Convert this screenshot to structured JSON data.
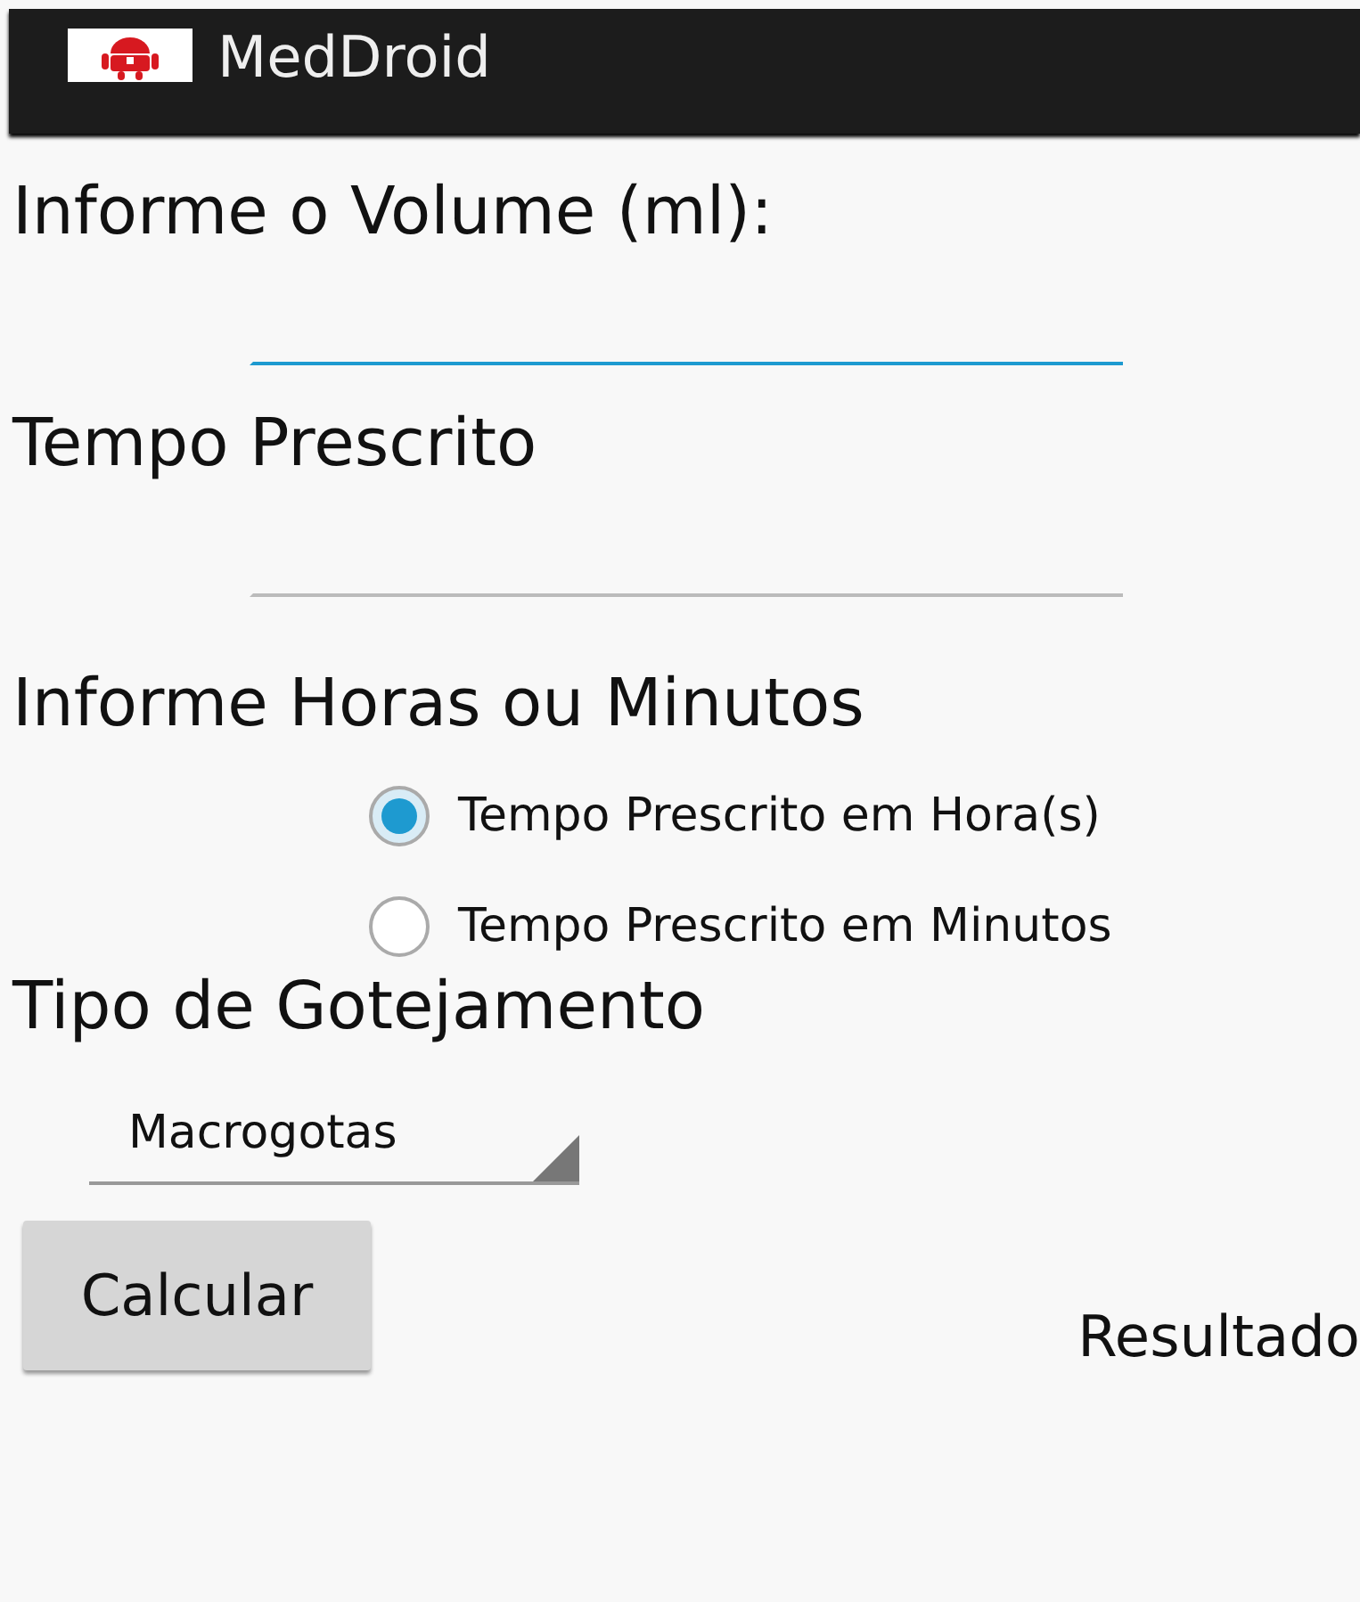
{
  "app_bar": {
    "title": "MedDroid"
  },
  "volume": {
    "label": "Informe o Volume (ml):",
    "focused": true
  },
  "time": {
    "label": "Tempo Prescrito",
    "focused": false
  },
  "unit": {
    "label": "Informe Horas ou Minutos",
    "options": [
      {
        "label": "Tempo Prescrito em Hora(s)",
        "selected": true
      },
      {
        "label": "Tempo Prescrito em Minutos",
        "selected": false
      }
    ]
  },
  "drip": {
    "label": "Tipo de Gotejamento",
    "value": "Macrogotas"
  },
  "button": "Calcular",
  "result": "Resultado"
}
